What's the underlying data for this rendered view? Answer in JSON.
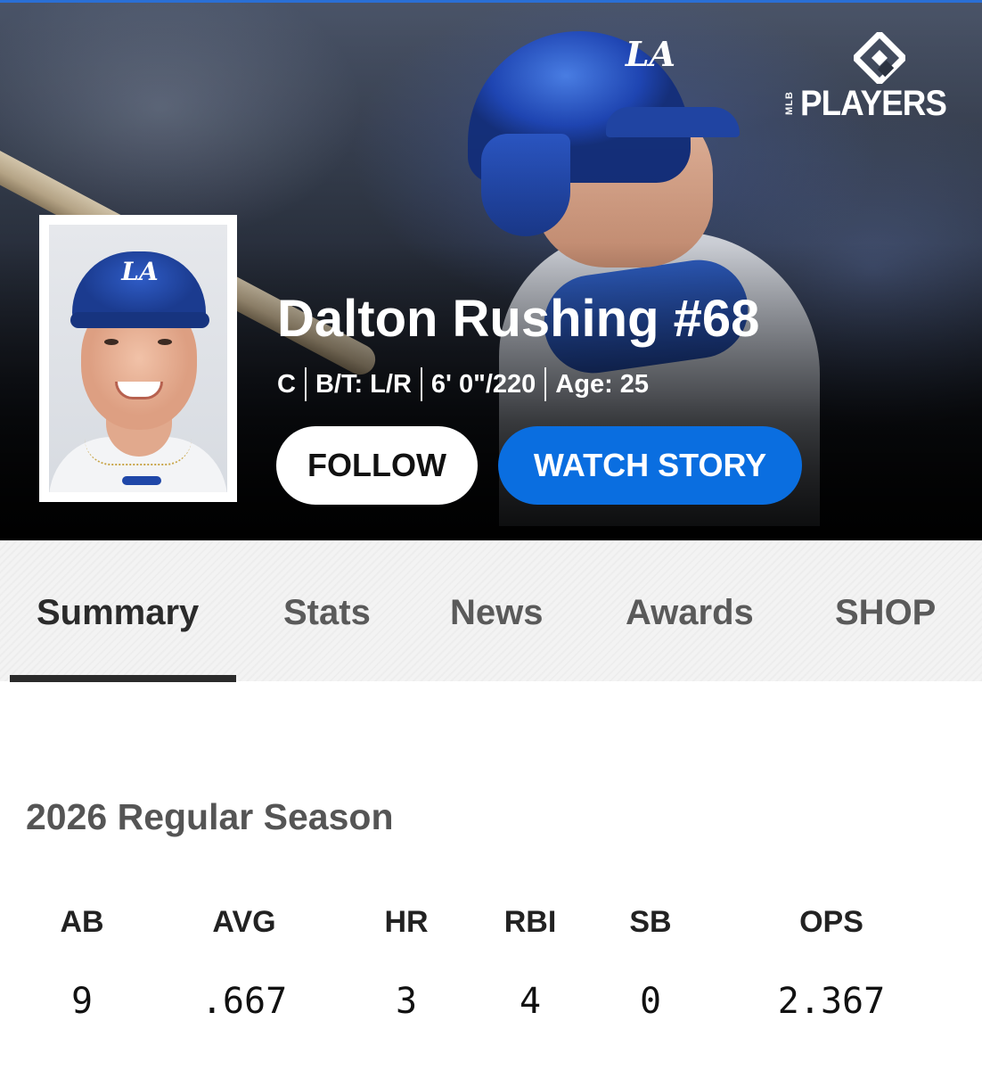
{
  "brand": {
    "small_text": "MLB",
    "name": "PLAYERS"
  },
  "hero": {
    "helmet_logo": "LA",
    "cap_logo": "LA"
  },
  "player": {
    "name_line": "Dalton Rushing #68",
    "position": "C",
    "bats_throws": "B/T: L/R",
    "height_weight": "6' 0\"/220",
    "age": "Age: 25"
  },
  "actions": {
    "follow_label": "FOLLOW",
    "watch_label": "WATCH STORY"
  },
  "tabs": [
    {
      "label": "Summary",
      "active": true
    },
    {
      "label": "Stats",
      "active": false
    },
    {
      "label": "News",
      "active": false
    },
    {
      "label": "Awards",
      "active": false
    },
    {
      "label": "SHOP",
      "active": false
    }
  ],
  "season": {
    "title": "2026 Regular Season",
    "stats": [
      {
        "label": "AB",
        "value": "9"
      },
      {
        "label": "AVG",
        "value": ".667"
      },
      {
        "label": "HR",
        "value": "3"
      },
      {
        "label": "RBI",
        "value": "4"
      },
      {
        "label": "SB",
        "value": "0"
      },
      {
        "label": "OPS",
        "value": "2.367"
      }
    ]
  },
  "colors": {
    "accent_blue": "#0a6ee0",
    "tab_active": "#2b2b2b",
    "tab_inactive": "#5a5a5a",
    "season_title": "#555555"
  }
}
